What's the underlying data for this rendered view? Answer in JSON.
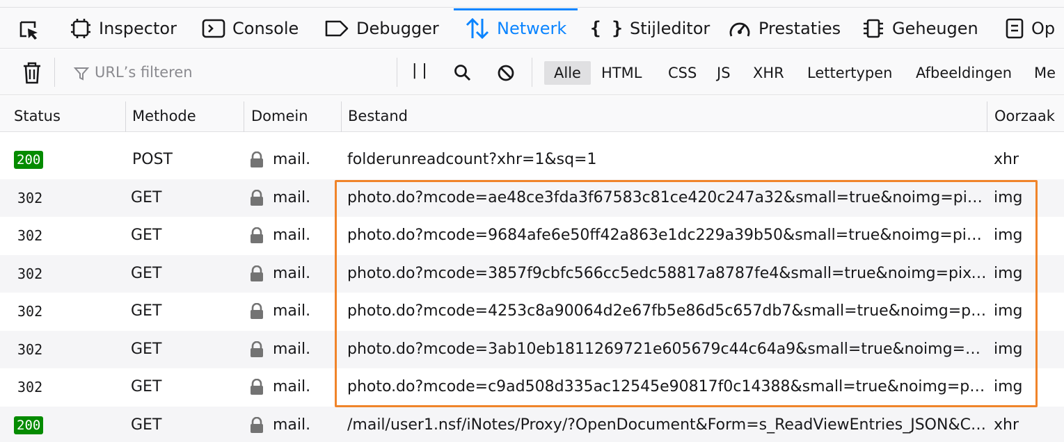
{
  "toolbar": {
    "tabs": [
      {
        "label": "Inspector",
        "icon": "inspector-icon"
      },
      {
        "label": "Console",
        "icon": "console-icon"
      },
      {
        "label": "Debugger",
        "icon": "debugger-icon"
      },
      {
        "label": "Netwerk",
        "icon": "network-icon",
        "active": true
      },
      {
        "label": "Stijleditor",
        "icon": "style-editor-icon"
      },
      {
        "label": "Prestaties",
        "icon": "performance-icon"
      },
      {
        "label": "Geheugen",
        "icon": "memory-icon"
      },
      {
        "label": "Op",
        "icon": "storage-icon"
      }
    ],
    "accent_color": "#0a84ff"
  },
  "filter": {
    "placeholder": "URL’s filteren",
    "pause_label": "| |",
    "types": [
      "Alle",
      "HTML",
      "CSS",
      "JS",
      "XHR",
      "Lettertypen",
      "Afbeeldingen",
      "Me"
    ],
    "active_type": "Alle"
  },
  "table": {
    "columns": [
      "Status",
      "Methode",
      "Domein",
      "Bestand",
      "Oorzaak"
    ],
    "rows": [
      {
        "status": "200",
        "method": "POST",
        "domain": "mail.",
        "file": "folderunreadcount?xhr=1&sq=1",
        "cause": "xhr"
      },
      {
        "status": "302",
        "method": "GET",
        "domain": "mail.",
        "file": "photo.do?mcode=ae48ce3fda3f67583c81ce420c247a32&small=true&noimg=pixel...",
        "cause": "img"
      },
      {
        "status": "302",
        "method": "GET",
        "domain": "mail.",
        "file": "photo.do?mcode=9684afe6e50ff42a863e1dc229a39b50&small=true&noimg=pixel...",
        "cause": "img"
      },
      {
        "status": "302",
        "method": "GET",
        "domain": "mail.",
        "file": "photo.do?mcode=3857f9cbfc566cc5edc58817a8787fe4&small=true&noimg=pixel...",
        "cause": "img"
      },
      {
        "status": "302",
        "method": "GET",
        "domain": "mail.",
        "file": "photo.do?mcode=4253c8a90064d2e67fb5e86d5c657db7&small=true&noimg=pix...",
        "cause": "img"
      },
      {
        "status": "302",
        "method": "GET",
        "domain": "mail.",
        "file": "photo.do?mcode=3ab10eb1811269721e605679c44c64a9&small=true&noimg=pi...",
        "cause": "img"
      },
      {
        "status": "302",
        "method": "GET",
        "domain": "mail.",
        "file": "photo.do?mcode=c9ad508d335ac12545e90817f0c14388&small=true&noimg=pix...",
        "cause": "img"
      },
      {
        "status": "200",
        "method": "GET",
        "domain": "mail.",
        "file": "/mail/user1.nsf/iNotes/Proxy/?OpenDocument&Form=s_ReadViewEntries_JSON&Co...",
        "cause": "xhr"
      }
    ]
  },
  "colors": {
    "status_ok_badge": "#058b00",
    "highlight_border": "#f0842a"
  }
}
